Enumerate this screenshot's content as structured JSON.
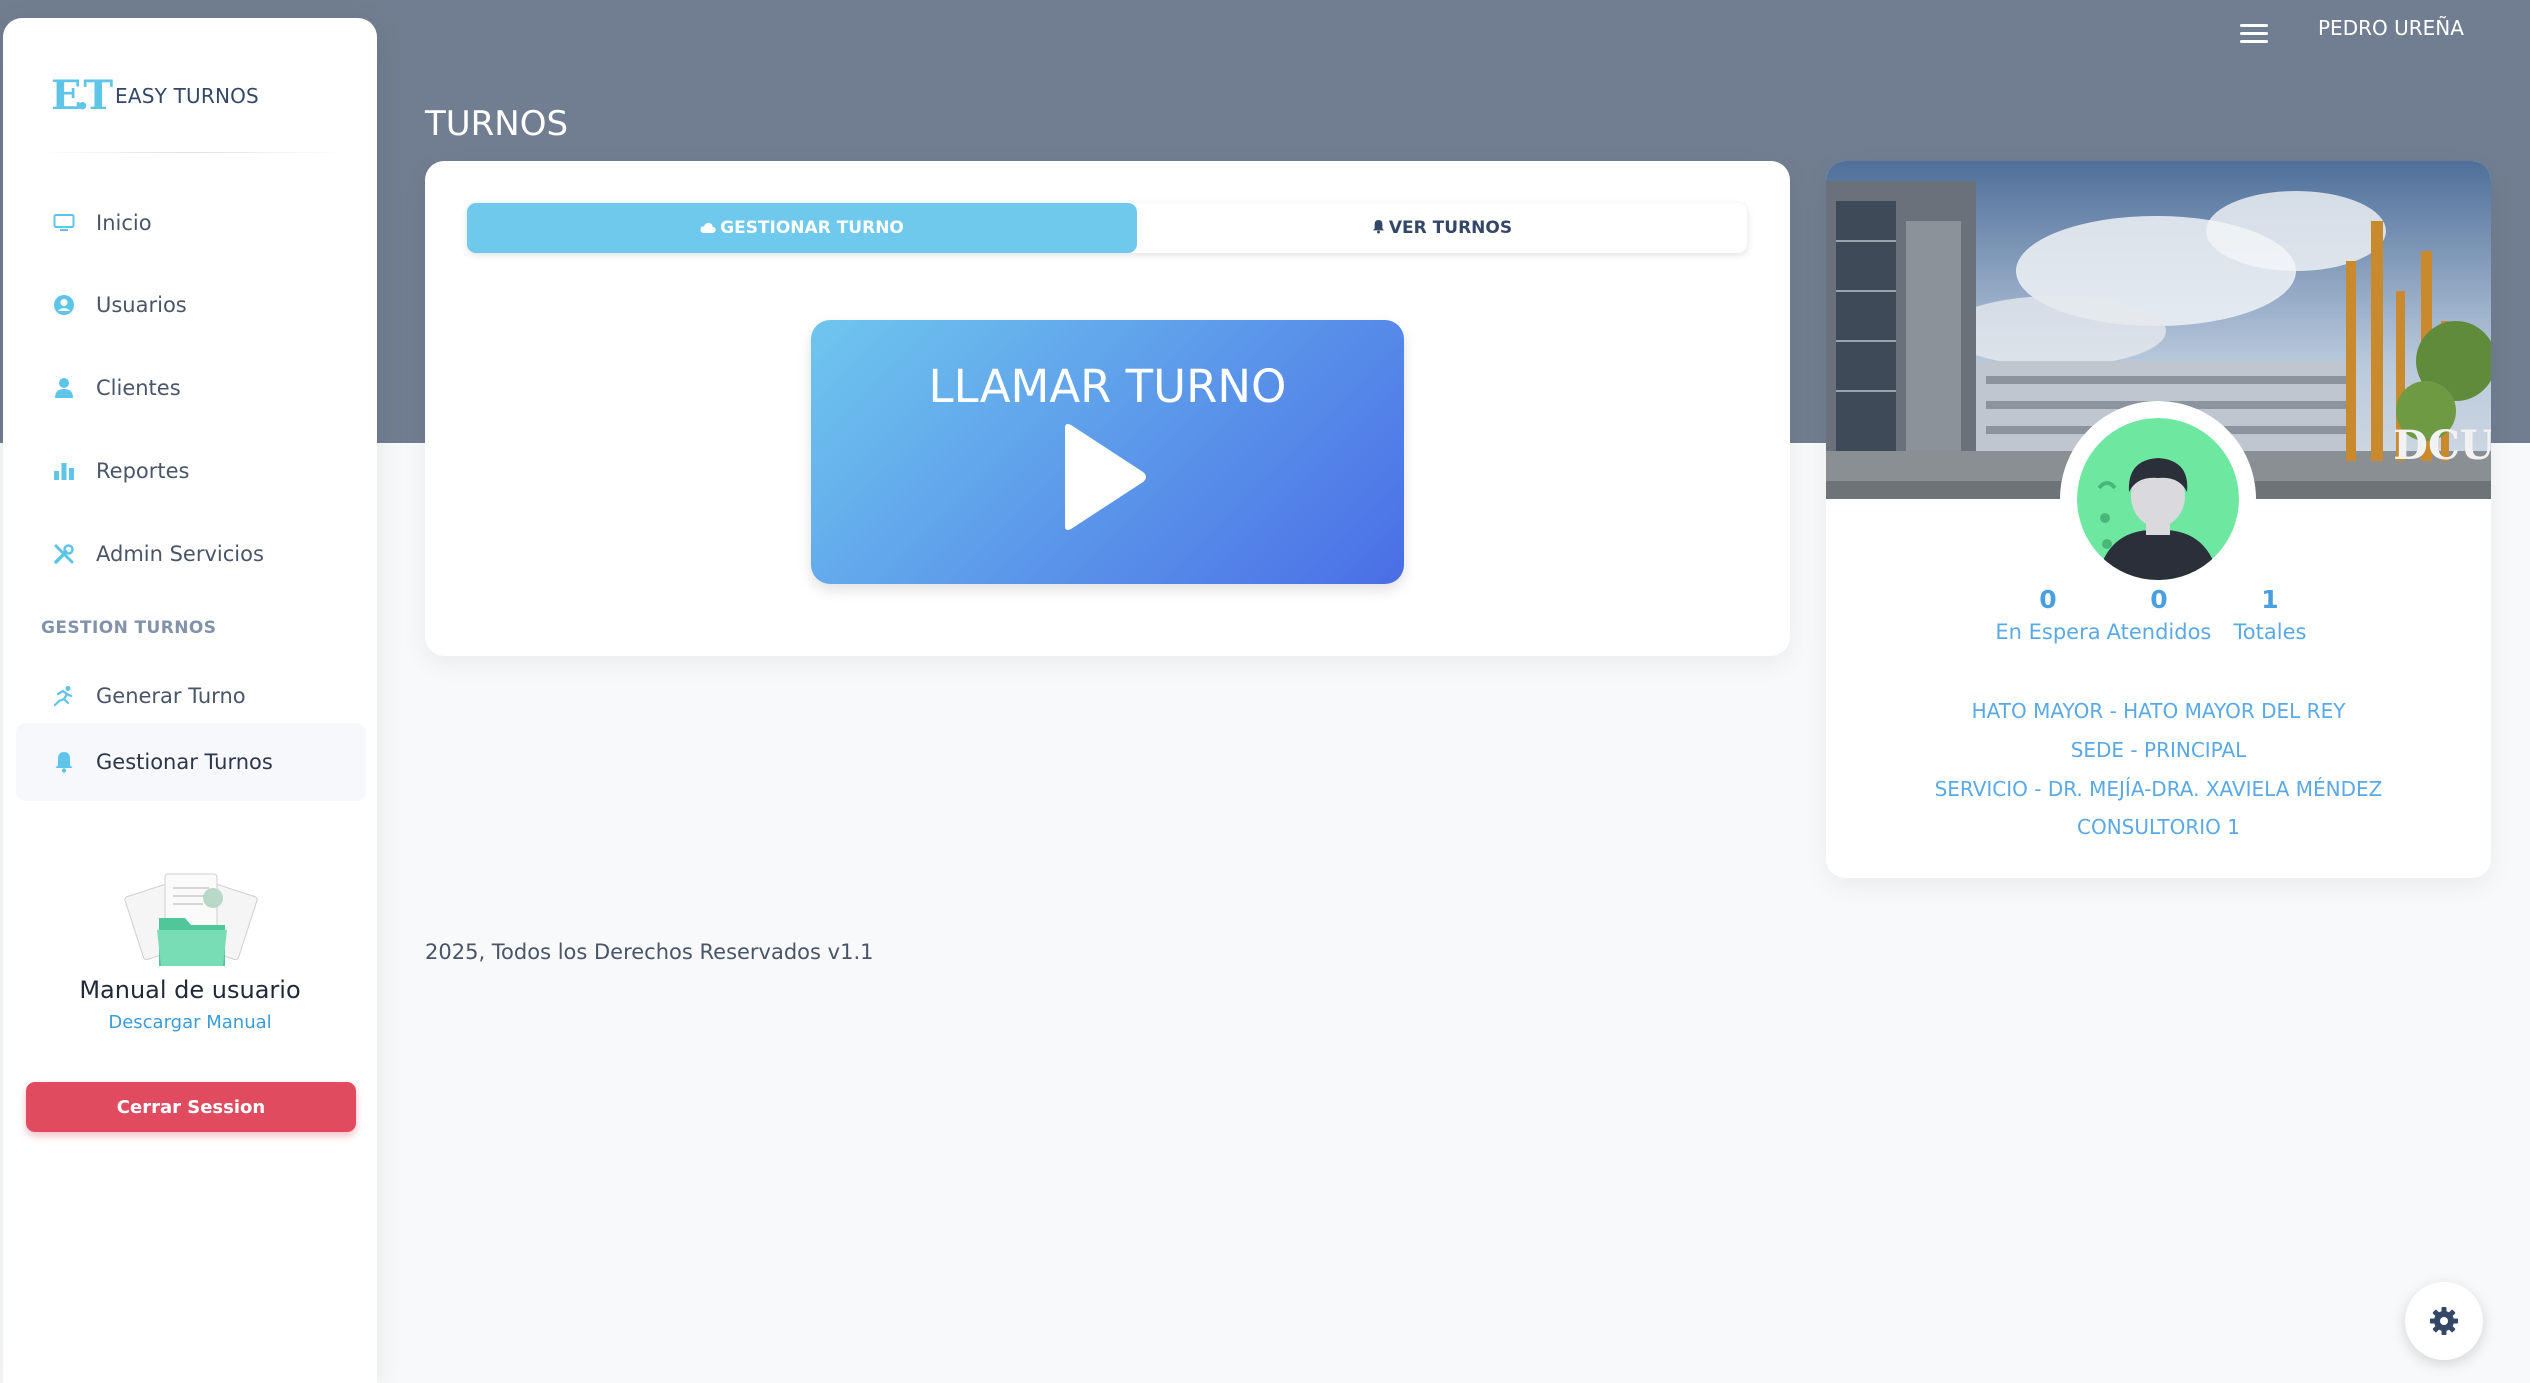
{
  "brand": {
    "logo_text": "E.T",
    "name": "EASY TURNOS"
  },
  "sidebar": {
    "items": [
      {
        "label": "Inicio",
        "icon": "monitor-icon"
      },
      {
        "label": "Usuarios",
        "icon": "user-circle-icon"
      },
      {
        "label": "Clientes",
        "icon": "person-icon"
      },
      {
        "label": "Reportes",
        "icon": "bar-chart-icon"
      },
      {
        "label": "Admin Servicios",
        "icon": "tools-icon"
      }
    ],
    "section_title": "GESTION TURNOS",
    "section_items": [
      {
        "label": "Generar Turno",
        "icon": "running-person-icon"
      },
      {
        "label": "Gestionar Turnos",
        "icon": "bell-icon",
        "active": true
      }
    ],
    "manual": {
      "title": "Manual de usuario",
      "link": "Descargar Manual"
    },
    "logout_label": "Cerrar Session"
  },
  "header": {
    "user_name": "PEDRO UREÑA",
    "menu_icon": "hamburger-icon"
  },
  "page": {
    "title": "TURNOS"
  },
  "tabs": [
    {
      "label": "GESTIONAR TURNO",
      "icon": "cloud-icon",
      "active": true
    },
    {
      "label": "VER TURNOS",
      "icon": "bell-icon",
      "active": false
    }
  ],
  "call_button": {
    "label": "LLAMAR TURNO",
    "icon": "play-icon"
  },
  "profile": {
    "cover_text": "DCU",
    "stats": [
      {
        "value": "0",
        "label": "En Espera"
      },
      {
        "value": "0",
        "label": "Atendidos"
      },
      {
        "value": "1",
        "label": "Totales"
      }
    ],
    "info": [
      "HATO MAYOR - HATO MAYOR DEL REY",
      "SEDE - PRINCIPAL",
      "SERVICIO - DR. MEJÍA-DRA. XAVIELA MÉNDEZ",
      "CONSULTORIO 1"
    ]
  },
  "footer": {
    "text": "2025, Todos los Derechos Reservados v1.1"
  },
  "colors": {
    "accent": "#5ec4e8",
    "header_bg": "#717e91",
    "danger": "#e04b5f",
    "info_text": "#5aa9e6"
  }
}
